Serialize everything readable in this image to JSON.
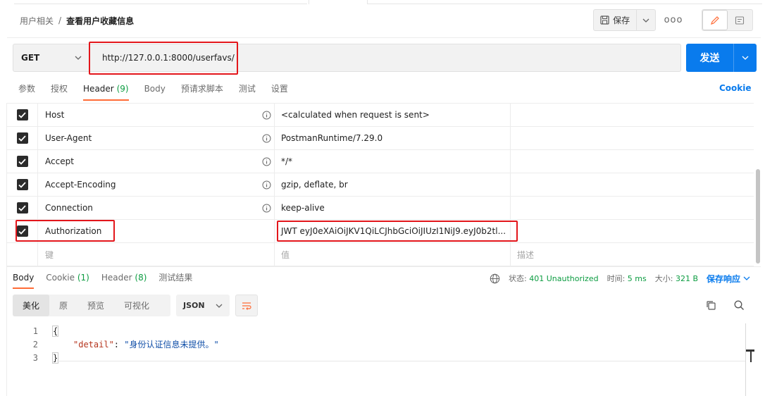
{
  "breadcrumb": {
    "parent": "用户相关",
    "separator": "/",
    "current": "查看用户收藏信息"
  },
  "toolbar": {
    "save_label": "保存",
    "more_label": "ooo"
  },
  "request": {
    "method": "GET",
    "url": "http://127.0.0.1:8000/userfavs/",
    "send_label": "发送"
  },
  "req_tabs": {
    "params": "参数",
    "auth": "授权",
    "headers": "Header",
    "headers_count": "(9)",
    "body": "Body",
    "prerequest": "预请求脚本",
    "tests": "测试",
    "settings": "设置",
    "cookies": "Cookie"
  },
  "headers": [
    {
      "key": "Host",
      "value": "<calculated when request is sent>",
      "checked": true
    },
    {
      "key": "User-Agent",
      "value": "PostmanRuntime/7.29.0",
      "checked": true
    },
    {
      "key": "Accept",
      "value": "*/*",
      "checked": true
    },
    {
      "key": "Accept-Encoding",
      "value": "gzip, deflate, br",
      "checked": true
    },
    {
      "key": "Connection",
      "value": "keep-alive",
      "checked": true
    },
    {
      "key": "Authorization",
      "value": "JWT eyJ0eXAiOiJKV1QiLCJhbGciOiJIUzI1NiJ9.eyJ0b2tl...",
      "checked": true
    }
  ],
  "header_placeholders": {
    "key": "键",
    "value": "值",
    "description": "描述"
  },
  "response": {
    "tabs": {
      "body": "Body",
      "cookies": "Cookie",
      "cookies_count": "(1)",
      "headers": "Header",
      "headers_count": "(8)",
      "tests": "测试结果"
    },
    "status_label": "状态:",
    "status_value": "401 Unauthorized",
    "time_label": "时间:",
    "time_value": "5 ms",
    "size_label": "大小:",
    "size_value": "321 B",
    "save_label": "保存响应",
    "formats": [
      "美化",
      "原",
      "预览",
      "可视化"
    ],
    "language": "JSON",
    "lines": [
      "1",
      "2",
      "3"
    ],
    "code_open": "{",
    "code_key": "\"detail\"",
    "code_colon": ": ",
    "code_value": "\"身份认证信息未提供。\"",
    "code_close": "}"
  },
  "colors": {
    "accent_orange": "#ff6c37",
    "send_blue": "#097bed",
    "status_green": "#0c9c41",
    "highlight_red": "#e3161b"
  }
}
